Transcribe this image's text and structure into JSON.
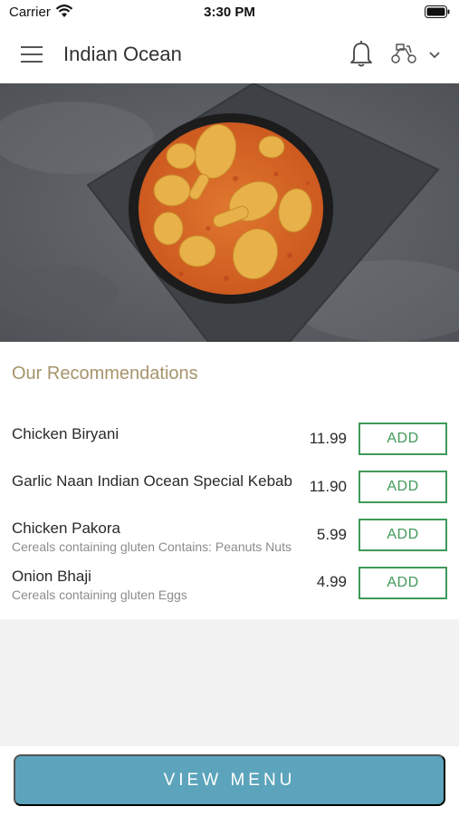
{
  "status_bar": {
    "carrier": "Carrier",
    "time": "3:30 PM"
  },
  "header": {
    "title": "Indian Ocean",
    "icons": [
      "menu-icon",
      "bell-icon",
      "delivery-icon",
      "chevron-down-icon"
    ]
  },
  "hero": {
    "icon": "curry-dish-image"
  },
  "recommendations": {
    "title": "Our Recommendations",
    "items": [
      {
        "name": "Chicken Biryani",
        "allergens": "",
        "price": "11.99",
        "add_label": "ADD"
      },
      {
        "name": "Garlic Naan Indian Ocean Special Kebab",
        "allergens": "",
        "price": "11.90",
        "add_label": "ADD"
      },
      {
        "name": "Chicken Pakora",
        "allergens": "Cereals containing gluten Contains: Peanuts Nuts",
        "price": "5.99",
        "add_label": "ADD"
      },
      {
        "name": "Onion Bhaji",
        "allergens": "Cereals containing gluten Eggs",
        "price": "4.99",
        "add_label": "ADD"
      }
    ]
  },
  "footer": {
    "view_menu_label": "VIEW MENU"
  },
  "colors": {
    "accent_gold": "#a6946b",
    "add_green": "#3f9a59",
    "button_blue": "#5ba4bb",
    "gray_bg": "#f2f2f2"
  }
}
